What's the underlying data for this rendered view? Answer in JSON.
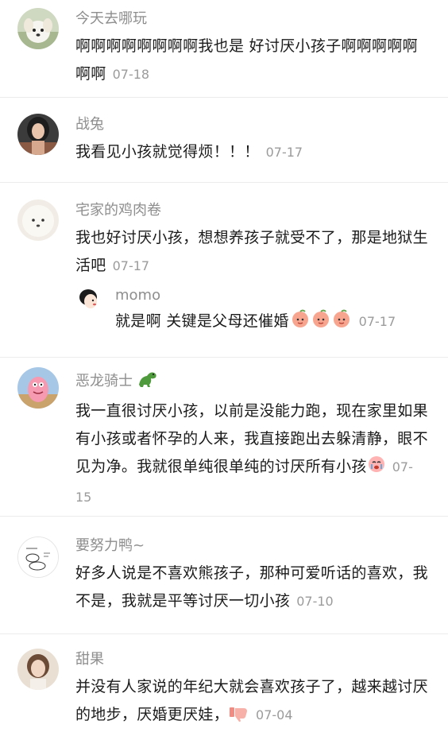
{
  "comments": [
    {
      "username": "今天去哪玩",
      "text": "啊啊啊啊啊啊啊啊我也是 好讨厌小孩子啊啊啊啊啊啊啊",
      "date": "07-18",
      "avatar": "white-puppy-avatar"
    },
    {
      "username": "战兔",
      "text": "我看见小孩就觉得烦！！！",
      "date": "07-17",
      "avatar": "woman-photo-avatar"
    },
    {
      "username": "宅家的鸡肉卷",
      "text": "我也好讨厌小孩，想想养孩子就受不了，那是地狱生活吧",
      "date": "07-17",
      "avatar": "fluffy-dog-avatar",
      "reply": {
        "username": "momo",
        "text": "就是啊 关键是父母还催婚",
        "date": "07-17",
        "emoji": "peach-face-emoji"
      }
    },
    {
      "username": "恶龙骑士",
      "username_emoji": "dinosaur-emoji",
      "text": "我一直很讨厌小孩，以前是没能力跑，现在家里如果有小孩或者怀孕的人来，我直接跑出去躲清静，眼不见为净。我就很单纯很单纯的讨厌所有小孩",
      "date": "07-15",
      "emoji": "crying-face-emoji",
      "avatar": "cartoon-patrick-avatar"
    },
    {
      "username": "要努力鸭~",
      "text": "好多人说是不喜欢熊孩子，那种可爱听话的喜欢，我不是，我就是平等讨厌一切小孩",
      "date": "07-10",
      "avatar": "sketch-drawing-avatar"
    },
    {
      "username": "甜果",
      "text": "并没有人家说的年纪大就会喜欢孩子了，越来越讨厌的地步，厌婚更厌娃，",
      "date": "07-04",
      "emoji": "thumbs-down-emoji",
      "avatar": "girl-photo-avatar"
    }
  ],
  "colors": {
    "username": "#8e8e8e",
    "text": "#1b1b1b",
    "date": "#9b9b9b",
    "divider": "#ececec"
  }
}
